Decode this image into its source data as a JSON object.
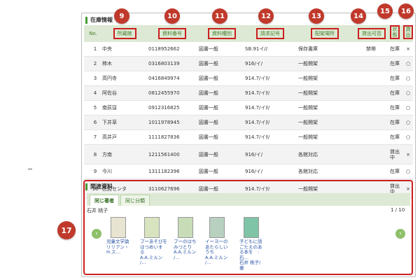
{
  "stock": {
    "heading": "在庫情報",
    "headers": {
      "no": "No.",
      "library": "所蔵館",
      "material_no": "資料番号",
      "material_type": "資料種別",
      "call_no": "請求記号",
      "shelf": "配架場所",
      "lendable": "貸出可否",
      "status": "状態",
      "lend": "貸出"
    },
    "rows": [
      {
        "no": "1",
        "library": "中央",
        "material_no": "0118952662",
        "type": "図書一般",
        "call_no": "SB.91イ//",
        "shelf": "保存書庫",
        "lendable": "禁帯",
        "status": "在庫",
        "lend": "×"
      },
      {
        "no": "2",
        "library": "柿木",
        "material_no": "0316803139",
        "type": "図書一般",
        "call_no": "916/イ/",
        "shelf": "一般開架",
        "lendable": "",
        "status": "在庫",
        "lend": "○"
      },
      {
        "no": "3",
        "library": "高円寺",
        "material_no": "0416849974",
        "type": "図書一般",
        "call_no": "914.7/イﾀ/",
        "shelf": "一般開架",
        "lendable": "",
        "status": "在庫",
        "lend": "○"
      },
      {
        "no": "4",
        "library": "阿佐谷",
        "material_no": "0812455970",
        "type": "図書一般",
        "call_no": "914.7/イﾀ/",
        "shelf": "一般開架",
        "lendable": "",
        "status": "在庫",
        "lend": "○"
      },
      {
        "no": "5",
        "library": "南荻窪",
        "material_no": "0912316825",
        "type": "図書一般",
        "call_no": "914.7/イﾀ/",
        "shelf": "一般開架",
        "lendable": "",
        "status": "在庫",
        "lend": "○"
      },
      {
        "no": "6",
        "library": "下井草",
        "material_no": "1011978945",
        "type": "図書一般",
        "call_no": "914.7/イﾀ/",
        "shelf": "一般開架",
        "lendable": "",
        "status": "在庫",
        "lend": "○"
      },
      {
        "no": "7",
        "library": "高井戸",
        "material_no": "1111827836",
        "type": "図書一般",
        "call_no": "914.7/イﾀ/",
        "shelf": "一般開架",
        "lendable": "",
        "status": "在庫",
        "lend": "○"
      },
      {
        "no": "8",
        "library": "方南",
        "material_no": "1211561400",
        "type": "図書一般",
        "call_no": "916/イ/",
        "shelf": "各館対応",
        "lendable": "",
        "status": "貸出\n中",
        "lend": "×"
      },
      {
        "no": "9",
        "library": "今川",
        "material_no": "1311182396",
        "type": "図書一般",
        "call_no": "916/イ/",
        "shelf": "各館対応",
        "lendable": "",
        "status": "在庫",
        "lend": "○"
      },
      {
        "no": "10",
        "library": "区民センタ",
        "material_no": "3110627696",
        "type": "図書一般",
        "call_no": "914.7/イﾀ/",
        "shelf": "一般開架",
        "lendable": "",
        "status": "貸出\n中",
        "lend": "×"
      }
    ]
  },
  "callouts": [
    "9",
    "10",
    "11",
    "12",
    "13",
    "14",
    "15",
    "16",
    "17"
  ],
  "related": {
    "heading": "関連資料",
    "tabs": [
      "同じ著者",
      "同じ分類"
    ],
    "author": "石井 桃子",
    "pager": "1 / 10",
    "prev": "‹",
    "next": "›",
    "books": [
      {
        "title": "児童文学論\nリリアン・\nH.ス…",
        "cover": "#e8e4d2"
      },
      {
        "title": "プーあそびを\nはつめいす\nる\nA.A.ミルン\n/…",
        "cover": "#d8e4c0"
      },
      {
        "title": "プーのはち\nみつとり\nA.A.ミルン\n/…",
        "cover": "#c8dcb8"
      },
      {
        "title": "イーヨーの\nあたらしい\nうち\nA.A.ミルン\n/…",
        "cover": "#b8d0c0"
      },
      {
        "title": "子どもに語\nごたえのあ\nる本を　:\n石…\n石井 桃子/\n著",
        "cover": "#7fc4a6"
      }
    ]
  },
  "colors": {
    "accent_green": "#4a9a36",
    "header_bg": "#dde9d4",
    "callout_red": "#c0392b",
    "highlight_border": "#cc1f1f",
    "link_blue": "#2a55a8"
  }
}
